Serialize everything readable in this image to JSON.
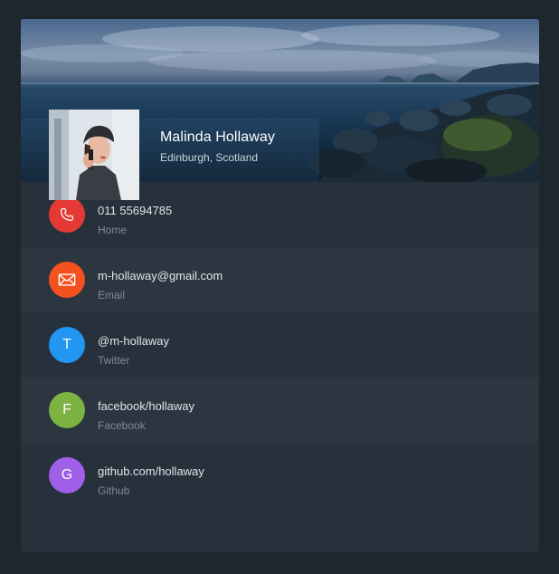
{
  "profile": {
    "name": "Malinda Hollaway",
    "location": "Edinburgh, Scotland"
  },
  "contacts": [
    {
      "icon": "phone-icon",
      "value": "011 55694785",
      "label": "Home",
      "color": "#e53935"
    },
    {
      "icon": "mail-icon",
      "value": "m-hollaway@gmail.com",
      "label": "Email",
      "color": "#f4511e"
    },
    {
      "icon": "twitter-icon",
      "letter": "T",
      "value": "@m-hollaway",
      "label": "Twitter",
      "color": "#2196f3"
    },
    {
      "icon": "facebook-icon",
      "letter": "F",
      "value": "facebook/hollaway",
      "label": "Facebook",
      "color": "#7cb342"
    },
    {
      "icon": "github-icon",
      "letter": "G",
      "value": "github.com/hollaway",
      "label": "Github",
      "color": "#a05fe8"
    }
  ]
}
